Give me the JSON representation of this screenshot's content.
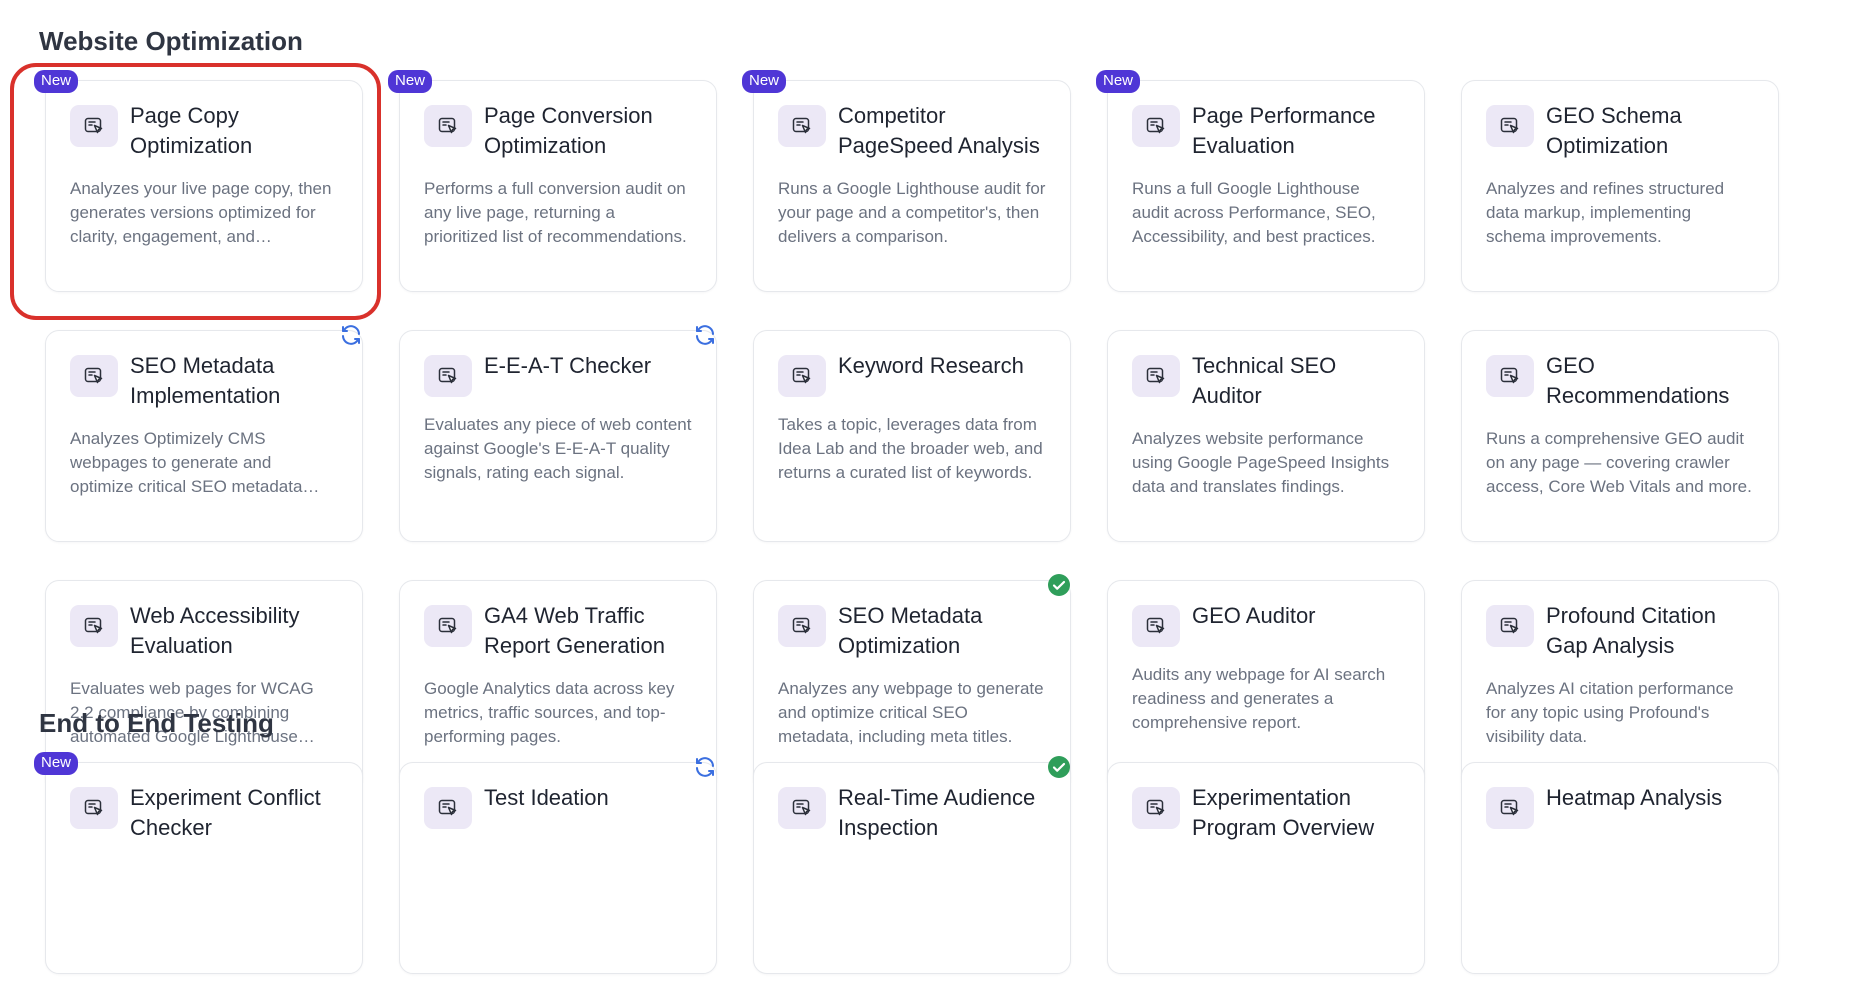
{
  "sections": [
    {
      "title": "Website Optimization",
      "cards": [
        {
          "title": "Page Copy Optimization",
          "description": "Analyzes your live page copy, then generates versions optimized for clarity, engagement, and conversion.",
          "badge": "New",
          "status": null,
          "icon": "agent-cursor-icon"
        },
        {
          "title": "Page Conversion Optimization",
          "description": "Performs a full conversion audit on any live page, returning a prioritized list of recommendations.",
          "badge": "New",
          "status": null,
          "icon": "agent-cursor-icon"
        },
        {
          "title": "Competitor PageSpeed Analysis",
          "description": "Runs a Google Lighthouse audit for your page and a competitor's, then delivers a comparison.",
          "badge": "New",
          "status": null,
          "icon": "agent-cursor-icon"
        },
        {
          "title": "Page Performance Evaluation",
          "description": "Runs a full Google Lighthouse audit across Performance, SEO, Accessibility, and best practices.",
          "badge": "New",
          "status": null,
          "icon": "agent-cursor-icon"
        },
        {
          "title": "GEO Schema Optimization",
          "description": "Analyzes and refines structured data markup, implementing schema improvements.",
          "badge": null,
          "status": null,
          "icon": "agent-cursor-icon"
        },
        {
          "title": "SEO Metadata Implementation",
          "description": "Analyzes Optimizely CMS webpages to generate and optimize critical SEO metadata fields.",
          "badge": null,
          "status": "sync",
          "icon": "agent-cursor-icon"
        },
        {
          "title": "E-E-A-T Checker",
          "description": "Evaluates any piece of web content against Google's E-E-A-T quality signals, rating each signal.",
          "badge": null,
          "status": "sync",
          "icon": "agent-cursor-icon"
        },
        {
          "title": "Keyword Research",
          "description": "Takes a topic, leverages data from Idea Lab and the broader web, and returns a curated list of keywords.",
          "badge": null,
          "status": null,
          "icon": "agent-cursor-icon"
        },
        {
          "title": "Technical SEO Auditor",
          "description": "Analyzes website performance using Google PageSpeed Insights data and translates findings.",
          "badge": null,
          "status": null,
          "icon": "agent-cursor-icon"
        },
        {
          "title": "GEO Recommendations",
          "description": "Runs a comprehensive GEO audit on any page — covering crawler access, Core Web Vitals and more.",
          "badge": null,
          "status": null,
          "icon": "agent-cursor-icon"
        },
        {
          "title": "Web Accessibility Evaluation",
          "description": "Evaluates web pages for WCAG 2.2 compliance by combining automated Google Lighthouse checks.",
          "badge": null,
          "status": null,
          "icon": "agent-cursor-icon"
        },
        {
          "title": "GA4 Web Traffic Report Generation",
          "description": "Google Analytics data across key metrics, traffic sources, and top-performing pages.",
          "badge": null,
          "status": null,
          "icon": "agent-cursor-icon"
        },
        {
          "title": "SEO Metadata Optimization",
          "description": "Analyzes any webpage to generate and optimize critical SEO metadata, including meta titles.",
          "badge": null,
          "status": "check",
          "icon": "agent-cursor-icon"
        },
        {
          "title": "GEO Auditor",
          "description": "Audits any webpage for AI search readiness and generates a comprehensive report.",
          "badge": null,
          "status": null,
          "icon": "agent-cursor-icon"
        },
        {
          "title": "Profound Citation Gap Analysis",
          "description": "Analyzes AI citation performance for any topic using Profound's visibility data.",
          "badge": null,
          "status": null,
          "icon": "agent-cursor-icon"
        }
      ]
    },
    {
      "title": "End to End Testing",
      "cards": [
        {
          "title": "Experiment Conflict Checker",
          "description": "",
          "badge": "New",
          "status": null,
          "icon": "agent-cursor-icon"
        },
        {
          "title": "Test Ideation",
          "description": "",
          "badge": null,
          "status": "sync",
          "icon": "agent-cursor-icon"
        },
        {
          "title": "Real-Time Audience Inspection",
          "description": "",
          "badge": null,
          "status": "check",
          "icon": "agent-cursor-icon"
        },
        {
          "title": "Experimentation Program Overview",
          "description": "",
          "badge": null,
          "status": null,
          "icon": "agent-cursor-icon"
        },
        {
          "title": "Heatmap Analysis",
          "description": "",
          "badge": null,
          "status": null,
          "icon": "agent-cursor-icon"
        }
      ]
    }
  ],
  "colors": {
    "badge_bg": "#4f36d6",
    "sync_icon": "#3b6fe0",
    "check_icon": "#2f9e5a",
    "highlight": "#d9312b",
    "icon_bg": "#ece8f6"
  }
}
